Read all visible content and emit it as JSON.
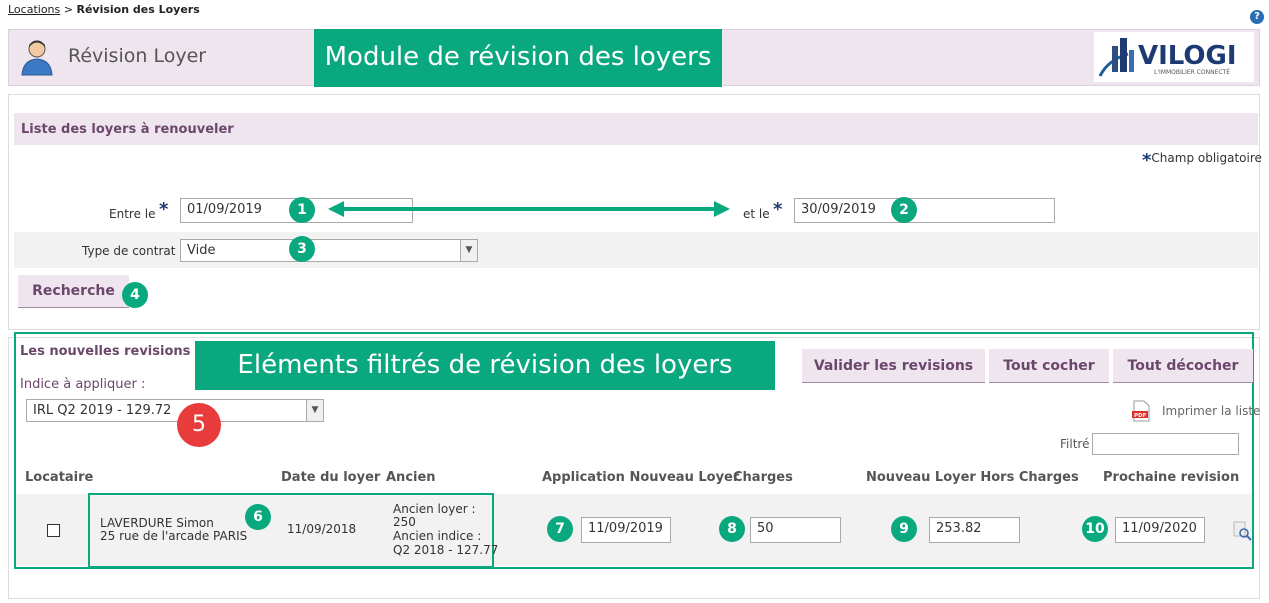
{
  "breadcrumb": {
    "parent": "Locations",
    "separator": " > ",
    "current": "Révision des Loyers"
  },
  "help_icon": "?",
  "header": {
    "title": "Révision Loyer",
    "callout": "Module de révision des loyers",
    "logo_text": "VILOGI",
    "logo_tagline": "L'IMMOBILIER CONNECTÉ"
  },
  "search": {
    "section_title": "Liste des loyers à renouveler",
    "required_note": "Champ obligatoire",
    "required_star": "*",
    "from_label": "Entre le",
    "from_value": "01/09/2019",
    "to_label": "et le",
    "to_value": "30/09/2019",
    "contract_label": "Type de contrat",
    "contract_value": "Vide",
    "search_button": "Recherche"
  },
  "badges": {
    "b1": "1",
    "b2": "2",
    "b3": "3",
    "b4": "4",
    "b5": "5",
    "b6": "6",
    "b7": "7",
    "b8": "8",
    "b9": "9",
    "b10": "10"
  },
  "revisions": {
    "section_title": "Les nouvelles revisions",
    "callout": "Eléments filtrés de révision des loyers",
    "indice_label": "Indice à appliquer :",
    "indice_value": "IRL Q2 2019 - 129.72",
    "buttons": {
      "validate": "Valider les revisions",
      "check_all": "Tout cocher",
      "uncheck_all": "Tout décocher"
    },
    "print_label": "Imprimer la liste",
    "filter_label": "Filtré",
    "filter_value": "",
    "columns": {
      "tenant": "Locataire",
      "rent_date": "Date du loyer",
      "old": "Ancien",
      "new_rent_application": "Application Nouveau Loyer",
      "charges": "Charges",
      "new_rent_excl_charges": "Nouveau Loyer Hors Charges",
      "next_revision": "Prochaine revision"
    },
    "row": {
      "tenant_name": "LAVERDURE Simon",
      "tenant_address": "25 rue de l'arcade PARIS",
      "rent_date": "11/09/2018",
      "old_rent_label": "Ancien loyer :",
      "old_rent_value": "250",
      "old_index_label": "Ancien indice :",
      "old_index_value": "Q2 2018 - 127.77",
      "application_date": "11/09/2019",
      "charges": "50",
      "new_rent": "253.82",
      "next_revision": "11/09/2020"
    }
  },
  "colors": {
    "accent_green": "#0aa87e",
    "header_mauve": "#efe5ef",
    "title_purple": "#6b476b",
    "star_blue": "#1d3a72",
    "badge_red": "#e83c3c"
  }
}
